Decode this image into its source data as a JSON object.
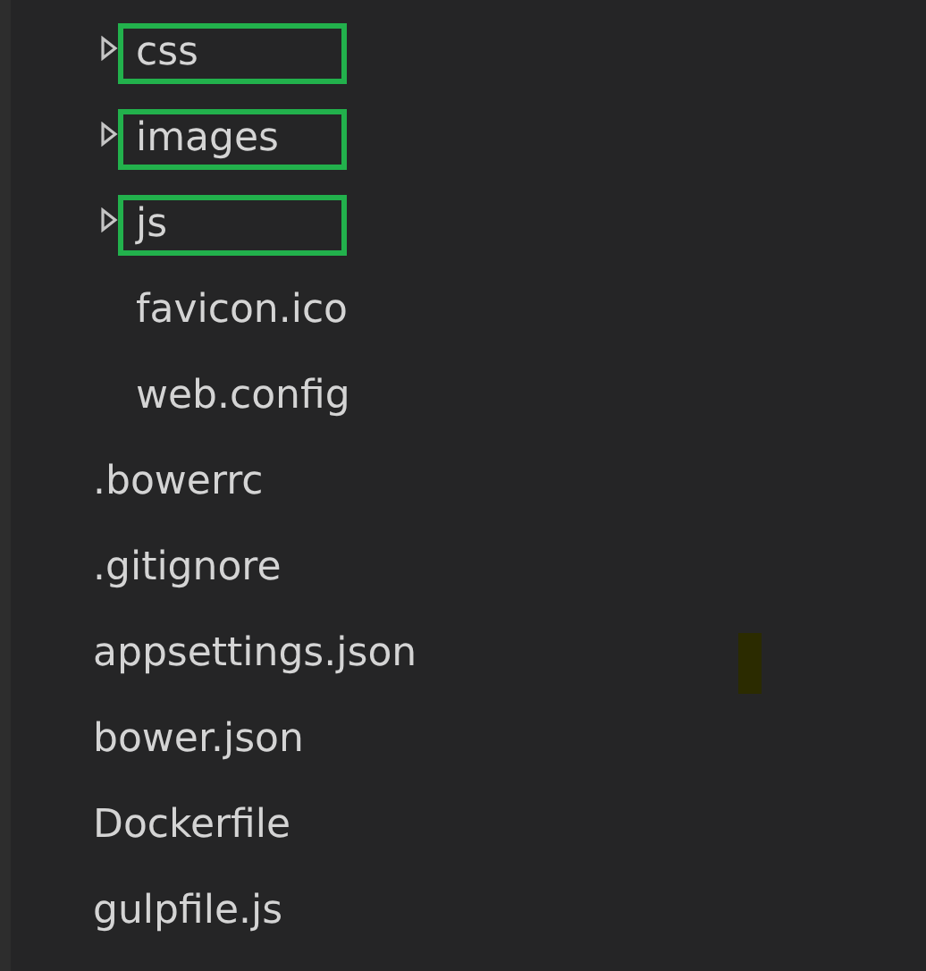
{
  "tree": [
    {
      "children": [
        {
          "label": "css",
          "expanded": false,
          "highlighted": true
        },
        {
          "label": "images",
          "expanded": false,
          "highlighted": true
        },
        {
          "label": "js",
          "expanded": false,
          "highlighted": true
        },
        {
          "label": "favicon.ico",
          "highlighted": false
        },
        {
          "label": "web.config",
          "highlighted": false
        }
      ]
    },
    {
      "label": ".bowerrc",
      "highlighted": false
    },
    {
      "label": ".gitignore",
      "highlighted": false
    },
    {
      "label": "appsettings.json",
      "highlighted": false
    },
    {
      "label": "bower.json",
      "highlighted": false
    },
    {
      "label": "Dockerfile",
      "highlighted": false
    },
    {
      "label": "gulpfile.js",
      "highlighted": false
    }
  ]
}
